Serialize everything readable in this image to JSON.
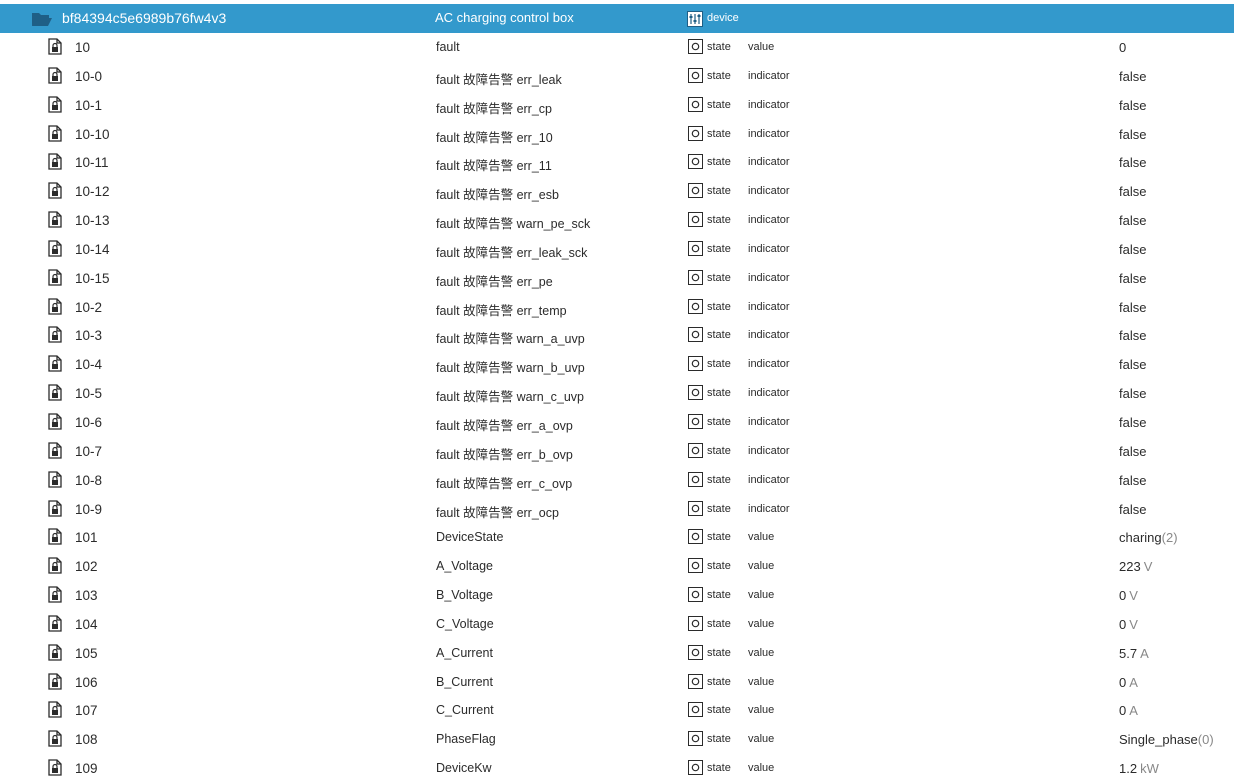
{
  "header": {
    "id": "bf84394c5e6989b76fw4v3",
    "name": "AC charging control box",
    "type": "device"
  },
  "colors": {
    "accent": "#3399cc",
    "text": "#2b2b2b",
    "unit": "#888888"
  },
  "icons": {
    "header": "folder-open-icon",
    "device": "device-icon",
    "row": "file-lock-icon",
    "state": "state-icon"
  },
  "rows": [
    {
      "id": "10",
      "name": "fault",
      "type": "state",
      "role": "value",
      "value": "0",
      "unit": ""
    },
    {
      "id": "10-0",
      "name": "fault 故障告警 err_leak",
      "type": "state",
      "role": "indicator",
      "value": "false",
      "unit": ""
    },
    {
      "id": "10-1",
      "name": "fault 故障告警 err_cp",
      "type": "state",
      "role": "indicator",
      "value": "false",
      "unit": ""
    },
    {
      "id": "10-10",
      "name": "fault 故障告警 err_10",
      "type": "state",
      "role": "indicator",
      "value": "false",
      "unit": ""
    },
    {
      "id": "10-11",
      "name": "fault 故障告警 err_11",
      "type": "state",
      "role": "indicator",
      "value": "false",
      "unit": ""
    },
    {
      "id": "10-12",
      "name": "fault 故障告警 err_esb",
      "type": "state",
      "role": "indicator",
      "value": "false",
      "unit": ""
    },
    {
      "id": "10-13",
      "name": "fault 故障告警 warn_pe_sck",
      "type": "state",
      "role": "indicator",
      "value": "false",
      "unit": ""
    },
    {
      "id": "10-14",
      "name": "fault 故障告警 err_leak_sck",
      "type": "state",
      "role": "indicator",
      "value": "false",
      "unit": ""
    },
    {
      "id": "10-15",
      "name": "fault 故障告警 err_pe",
      "type": "state",
      "role": "indicator",
      "value": "false",
      "unit": ""
    },
    {
      "id": "10-2",
      "name": "fault 故障告警 err_temp",
      "type": "state",
      "role": "indicator",
      "value": "false",
      "unit": ""
    },
    {
      "id": "10-3",
      "name": "fault 故障告警 warn_a_uvp",
      "type": "state",
      "role": "indicator",
      "value": "false",
      "unit": ""
    },
    {
      "id": "10-4",
      "name": "fault 故障告警 warn_b_uvp",
      "type": "state",
      "role": "indicator",
      "value": "false",
      "unit": ""
    },
    {
      "id": "10-5",
      "name": "fault 故障告警 warn_c_uvp",
      "type": "state",
      "role": "indicator",
      "value": "false",
      "unit": ""
    },
    {
      "id": "10-6",
      "name": "fault 故障告警 err_a_ovp",
      "type": "state",
      "role": "indicator",
      "value": "false",
      "unit": ""
    },
    {
      "id": "10-7",
      "name": "fault 故障告警 err_b_ovp",
      "type": "state",
      "role": "indicator",
      "value": "false",
      "unit": ""
    },
    {
      "id": "10-8",
      "name": "fault 故障告警 err_c_ovp",
      "type": "state",
      "role": "indicator",
      "value": "false",
      "unit": ""
    },
    {
      "id": "10-9",
      "name": "fault 故障告警 err_ocp",
      "type": "state",
      "role": "indicator",
      "value": "false",
      "unit": ""
    },
    {
      "id": "101",
      "name": "DeviceState",
      "type": "state",
      "role": "value",
      "value": "charing",
      "unit": "(2)"
    },
    {
      "id": "102",
      "name": "A_Voltage",
      "type": "state",
      "role": "value",
      "value": "223",
      "unit": "V"
    },
    {
      "id": "103",
      "name": "B_Voltage",
      "type": "state",
      "role": "value",
      "value": "0",
      "unit": "V"
    },
    {
      "id": "104",
      "name": "C_Voltage",
      "type": "state",
      "role": "value",
      "value": "0",
      "unit": "V"
    },
    {
      "id": "105",
      "name": "A_Current",
      "type": "state",
      "role": "value",
      "value": "5.7",
      "unit": "A"
    },
    {
      "id": "106",
      "name": "B_Current",
      "type": "state",
      "role": "value",
      "value": "0",
      "unit": "A"
    },
    {
      "id": "107",
      "name": "C_Current",
      "type": "state",
      "role": "value",
      "value": "0",
      "unit": "A"
    },
    {
      "id": "108",
      "name": "PhaseFlag",
      "type": "state",
      "role": "value",
      "value": "Single_phase",
      "unit": "(0)"
    },
    {
      "id": "109",
      "name": "DeviceKw",
      "type": "state",
      "role": "value",
      "value": "1.2",
      "unit": "kW"
    }
  ]
}
